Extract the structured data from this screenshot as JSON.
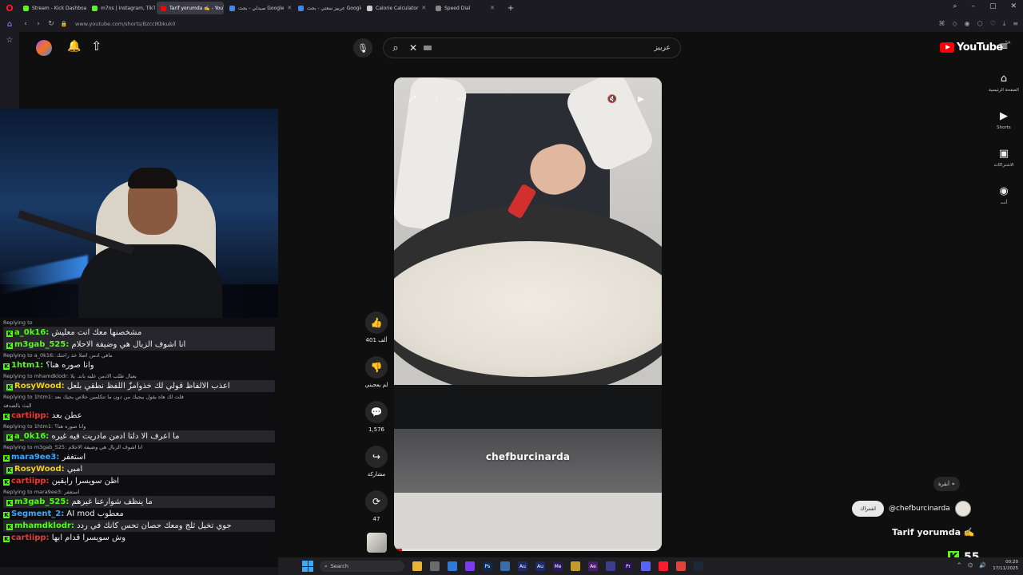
{
  "browser": {
    "tabs": [
      {
        "label": "Stream - Kick Dashboard",
        "color": "#53fc18",
        "active": false
      },
      {
        "label": "m7ns | Instagram, TikTok",
        "color": "#53fc18",
        "active": false
      },
      {
        "label": "Tarif yorumda ✍️ - YouTube",
        "color": "#ff0000",
        "active": true
      },
      {
        "label": "صيدلي - بحث Google",
        "color": "#4285f4",
        "active": false
      },
      {
        "label": "عربيز سعتي - بحث Google",
        "color": "#4285f4",
        "active": false
      },
      {
        "label": "Calorie Calculator",
        "color": "#cccccc",
        "active": false
      },
      {
        "label": "Speed Dial",
        "color": "#888888",
        "active": false
      }
    ],
    "url": "www.youtube.com/shorts/BzccIKbkuk0"
  },
  "header": {
    "search_text": "عربيز",
    "logo_text": "YouTube",
    "region": "SA"
  },
  "rail": [
    {
      "icon": "home-icon",
      "label": "الصفحة الرئيسية"
    },
    {
      "icon": "shorts-icon",
      "label": "Shorts"
    },
    {
      "icon": "subscriptions-icon",
      "label": "الاشتراكات"
    },
    {
      "icon": "you-icon",
      "label": "أنت"
    }
  ],
  "chat": {
    "lines": [
      {
        "reply": "Replying to",
        "user": "",
        "text": "",
        "color": "#ffffff",
        "hl": false
      },
      {
        "user": "a_0k16:",
        "text": "مشخصنها معك انت معليش",
        "color": "#53fc18",
        "hl": true
      },
      {
        "user": "m3gab_525:",
        "text": "انا اشوف الزبال هي وضيفة الاحلام",
        "color": "#53fc18",
        "hl": true
      },
      {
        "reply": "Replying to a_0k16: مافي ادمن اصلا خذ راحتك"
      },
      {
        "user": "1htm1:",
        "text": "وانا صوره هنا؟",
        "color": "#53fc18",
        "hl": false
      },
      {
        "reply": "Replying to mhamdklodr: يعيال طلب الادمن عليه باند. يلا"
      },
      {
        "user": "RosyWood:",
        "text": "اعذب الالفاظ قولي لك خذوامزّ اللفظ نطقي بلعل",
        "color": "#f5d000",
        "hl": true
      },
      {
        "reply": "Replying to 1htm1: قلت لك هاه يقول بيجيك من دون ما تتكلمين خلاص بجيك بعد"
      },
      {
        "reply": "البث بالصدفه"
      },
      {
        "user": "cartiipp:",
        "text": "عطن بعد",
        "color": "#e53935",
        "hl": false
      },
      {
        "reply": "Replying to 1htm1: وانا صوره هنا؟"
      },
      {
        "user": "a_0k16:",
        "text": "ما اعرف الا دلتا ادمن مادريت فيه غيره",
        "color": "#53fc18",
        "hl": true
      },
      {
        "reply": "Replying to m3gab_525: انا اشوف الزبال هي وضيفة الاحلام"
      },
      {
        "user": "mara9ee3:",
        "text": "استغفر",
        "color": "#3ba7ff",
        "hl": false
      },
      {
        "user": "RosyWood:",
        "text": "امبي",
        "color": "#f5d000",
        "hl": true
      },
      {
        "user": "cartiipp:",
        "text": "اظن سويسرا رايقين",
        "color": "#e53935",
        "hl": false
      },
      {
        "reply": "Replying to mara9ee3: استغفر"
      },
      {
        "user": "m3gab_525:",
        "text": "ما ينظف شوارعنا غيرهم",
        "color": "#53fc18",
        "hl": true
      },
      {
        "user": "Segment_2:",
        "text": "AI mod معطوب",
        "color": "#3ba7ff",
        "hl": false
      },
      {
        "user": "mhamdklodr:",
        "text": "جوي تخيل ثلج ومعك حصان تحس كانك في ردد",
        "color": "#53fc18",
        "hl": true
      },
      {
        "user": "cartiipp:",
        "text": "وش سويسرا قدام ابها",
        "color": "#e53935",
        "hl": false
      }
    ]
  },
  "video": {
    "caption": "chefburcinarda",
    "progress_pct": 3
  },
  "actions": [
    {
      "name": "like-button",
      "icon": "like-icon",
      "glyph": "👍",
      "label": "401 ألف"
    },
    {
      "name": "dislike-button",
      "icon": "dislike-icon",
      "glyph": "👎",
      "label": "لم يعجبني"
    },
    {
      "name": "comments-button",
      "icon": "comment-icon",
      "glyph": "💬",
      "label": "1,576"
    },
    {
      "name": "share-button",
      "icon": "share-icon",
      "glyph": "↪",
      "label": "مشاركة"
    },
    {
      "name": "remix-button",
      "icon": "remix-icon",
      "glyph": "⟳",
      "label": "47"
    }
  ],
  "channel": {
    "location": "أنقرة",
    "subscribe_label": "اشتراك",
    "handle": "@chefburcinarda",
    "title": "Tarif yorumda ✍️"
  },
  "kick": {
    "viewers": "55"
  },
  "taskbar": {
    "search_label": "Search",
    "time": "00:20",
    "date": "17/11/2025"
  },
  "colors": {
    "accent": "#ff0000",
    "kick_green": "#53fc18"
  }
}
